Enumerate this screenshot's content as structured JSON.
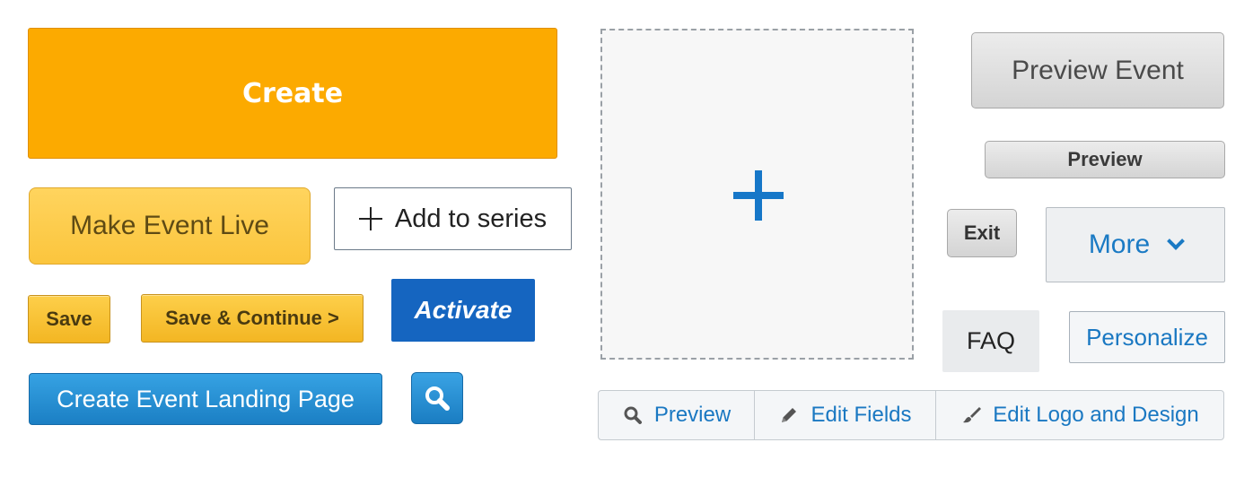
{
  "buttons": {
    "create": "Create",
    "make_live": "Make Event Live",
    "add_series": "Add to series",
    "save": "Save",
    "save_continue": "Save & Continue >",
    "activate": "Activate",
    "landing_page": "Create Event Landing Page",
    "preview_event": "Preview Event",
    "preview": "Preview",
    "exit": "Exit",
    "more": "More",
    "faq": "FAQ",
    "personalize": "Personalize"
  },
  "toolbar": {
    "preview": "Preview",
    "edit_fields": "Edit Fields",
    "edit_logo": "Edit Logo and Design"
  },
  "icons": {
    "search": "search-icon",
    "plus": "plus-icon",
    "chevron": "chevron-down-icon",
    "pencil": "pencil-icon",
    "brush": "brush-icon"
  },
  "colors": {
    "orange": "#fcaa00",
    "yellow": "#fbc53d",
    "blue": "#1565c0",
    "link_blue": "#1a78c2"
  }
}
